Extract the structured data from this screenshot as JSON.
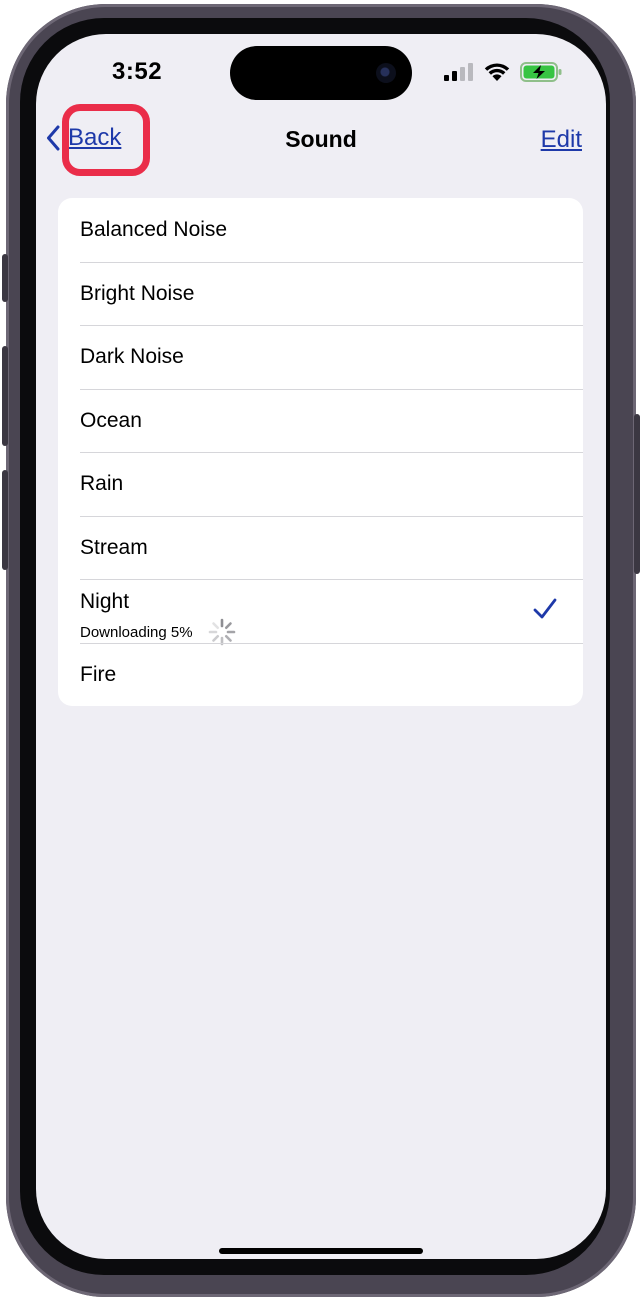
{
  "status_bar": {
    "time": "3:52"
  },
  "nav": {
    "back_label": "Back",
    "title": "Sound",
    "edit_label": "Edit"
  },
  "sounds": [
    {
      "name": "Balanced Noise"
    },
    {
      "name": "Bright Noise"
    },
    {
      "name": "Dark Noise"
    },
    {
      "name": "Ocean"
    },
    {
      "name": "Rain"
    },
    {
      "name": "Stream"
    },
    {
      "name": "Night",
      "status": "Downloading 5%",
      "selected": true
    },
    {
      "name": "Fire"
    }
  ],
  "colors": {
    "accent": "#1e39a9",
    "highlight": "#ea2d49",
    "background": "#efeef4"
  },
  "icons": {
    "back": "chevron-left-icon",
    "selected": "checkmark-icon",
    "loading": "spinner-icon"
  }
}
